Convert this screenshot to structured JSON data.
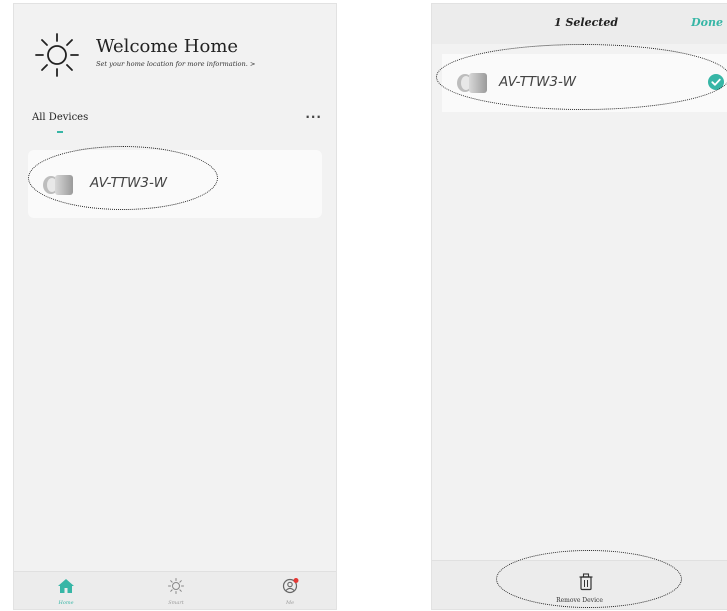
{
  "home_screen": {
    "header": {
      "title": "Welcome Home",
      "subtitle": "Set your home location for more information. >",
      "icon": "sun-icon"
    },
    "section": {
      "label": "All Devices",
      "more_label": "···"
    },
    "device": {
      "name": "AV-TTW3-W",
      "icon": "light-bulb-icon"
    },
    "tabs": [
      {
        "label": "Home",
        "icon": "home-icon",
        "active": true
      },
      {
        "label": "Smart",
        "icon": "sun-icon",
        "active": false
      },
      {
        "label": "Me",
        "icon": "user-icon",
        "active": false,
        "badge": true
      }
    ]
  },
  "selection_screen": {
    "topbar": {
      "selected_label": "1 Selected",
      "done_label": "Done"
    },
    "device": {
      "name": "AV-TTW3-W",
      "icon": "light-bulb-icon",
      "checked": true
    },
    "bottom_action": {
      "label": "Remove Device",
      "icon": "trash-icon"
    }
  },
  "colors": {
    "accent": "#37b6a6",
    "badge": "#e53935",
    "background": "#f2f2f2"
  }
}
